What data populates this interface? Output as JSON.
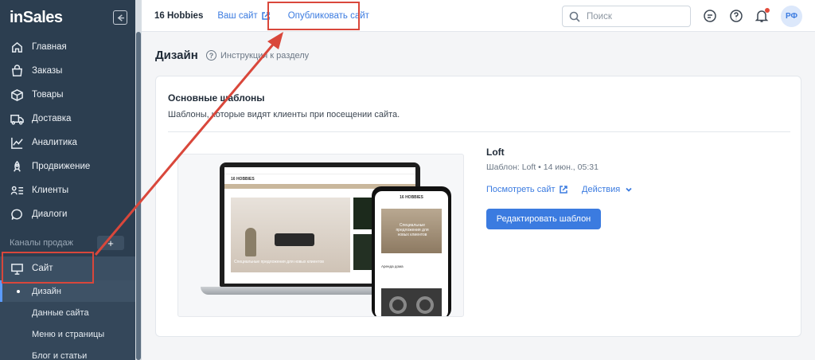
{
  "app": {
    "logo": "inSales"
  },
  "sidebar": {
    "items": [
      {
        "label": "Главная",
        "icon": "home-icon"
      },
      {
        "label": "Заказы",
        "icon": "shopping-bag-icon"
      },
      {
        "label": "Товары",
        "icon": "box-icon"
      },
      {
        "label": "Доставка",
        "icon": "truck-icon"
      },
      {
        "label": "Аналитика",
        "icon": "chart-line-icon"
      },
      {
        "label": "Продвижение",
        "icon": "rocket-icon"
      },
      {
        "label": "Клиенты",
        "icon": "clients-list-icon"
      },
      {
        "label": "Диалоги",
        "icon": "chat-icon"
      }
    ],
    "sales_channels_label": "Каналы продаж",
    "add_channel": "+",
    "site_item": {
      "label": "Сайт",
      "icon": "monitor-icon"
    },
    "sub_items": [
      {
        "label": "Дизайн",
        "active": true
      },
      {
        "label": "Данные сайта"
      },
      {
        "label": "Меню и страницы"
      },
      {
        "label": "Блог и статьи"
      }
    ]
  },
  "topbar": {
    "store_name": "16 Hobbies",
    "your_site": "Ваш сайт",
    "publish": "Опубликовать сайт",
    "search_placeholder": "Поиск",
    "avatar": "РФ"
  },
  "page": {
    "title": "Дизайн",
    "help_link": "Инструкция к разделу"
  },
  "card": {
    "title": "Основные шаблоны",
    "subtitle": "Шаблоны, которые видят клиенты при посещении сайта.",
    "theme_name": "Loft",
    "theme_meta": "Шаблон: Loft • 14 июн., 05:31",
    "view_site": "Посмотреть сайт",
    "actions": "Действия",
    "edit_button": "Редактировать шаблон"
  },
  "preview": {
    "laptop_store": "16 HOBBIES",
    "hero_text": "Специальные предложения для новых клиентов",
    "phone_store": "16 HOBBIES",
    "phone_hero": "Специальные предложения для новых клиентов",
    "phone_label": "Аренда дома"
  },
  "colors": {
    "sidebar_bg": "#2c3e50",
    "accent": "#3b7be0",
    "highlight": "#d9473b"
  }
}
